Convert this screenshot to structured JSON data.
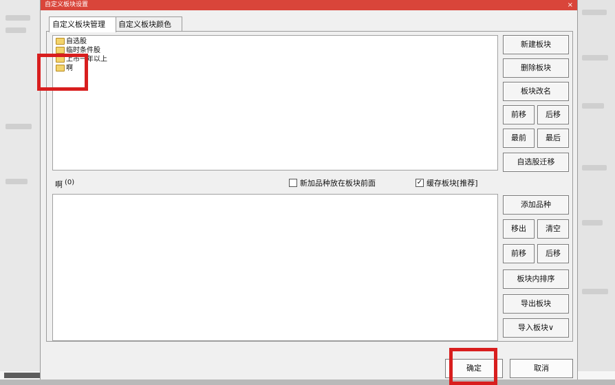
{
  "dialog": {
    "title": "自定义板块设置",
    "close_glyph": "×"
  },
  "tabs": [
    "自定义板块管理",
    "自定义板块颜色"
  ],
  "tree": {
    "items": [
      "自选股",
      "临时条件股",
      "上市一年以上",
      "啊"
    ]
  },
  "block_buttons": {
    "new": "新建板块",
    "delete": "删除板块",
    "rename": "板块改名",
    "move_up": "前移",
    "move_down": "后移",
    "to_first": "最前",
    "to_last": "最后",
    "migrate": "自选股迁移"
  },
  "block_info": {
    "label": "啊",
    "count": "(0)"
  },
  "options": {
    "new_front_label": "新加品种放在板块前面",
    "new_front_checked": false,
    "cache_label": "缓存板块[推荐]",
    "cache_checked": true,
    "check_glyph": "✓"
  },
  "item_buttons": {
    "add": "添加品种",
    "remove": "移出",
    "clear": "清空",
    "move_up": "前移",
    "move_down": "后移",
    "sort": "板块内排序",
    "export": "导出板块",
    "import": "导入板块∨"
  },
  "footer": {
    "ok": "确定",
    "cancel": "取消"
  },
  "colors": {
    "titlebar": "#d9453a",
    "highlight": "#d81e1e",
    "folder": "#f3d36b"
  }
}
